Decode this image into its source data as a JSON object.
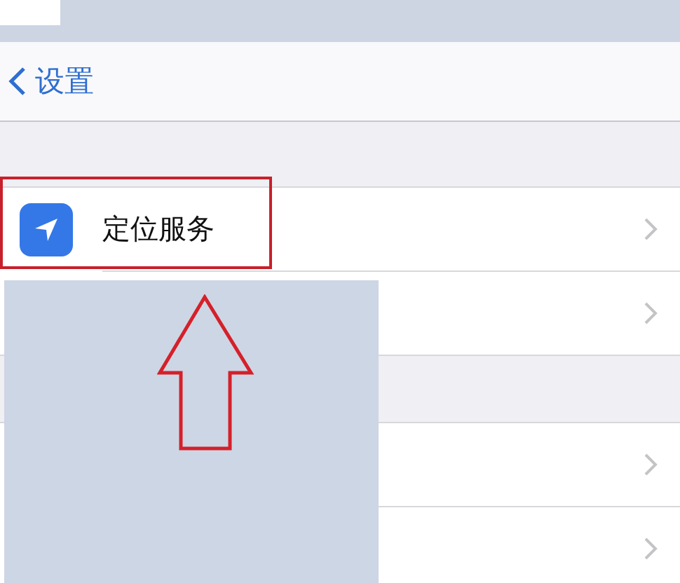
{
  "nav": {
    "back_label": "设置"
  },
  "sections": [
    {
      "rows": [
        {
          "kind": "labeled",
          "label": "定位服务"
        },
        {
          "kind": "covered"
        }
      ]
    },
    {
      "rows": [
        {
          "kind": "covered"
        },
        {
          "kind": "covered"
        }
      ]
    }
  ],
  "annotations": [
    {
      "kind": "box"
    },
    {
      "kind": "mask"
    },
    {
      "kind": "arrow"
    }
  ]
}
